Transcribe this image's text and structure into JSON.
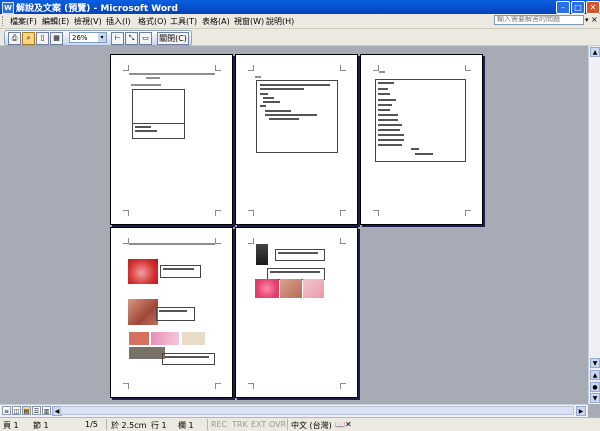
{
  "window": {
    "title": "解說及文案 (預覽) - Microsoft Word",
    "app_icon": "W",
    "min_glyph": "–",
    "max_glyph": "□",
    "close_glyph": "✕"
  },
  "menu": {
    "items": [
      "檔案(F)",
      "編輯(E)",
      "檢視(V)",
      "插入(I)",
      "格式(O)",
      "工具(T)",
      "表格(A)",
      "視窗(W)",
      "說明(H)"
    ],
    "help_placeholder": "輸入需要解答的問題",
    "help_arrow": "▾",
    "close_glyph": "×"
  },
  "toolbar": {
    "zoom_value": "26%",
    "zoom_arrow": "▾",
    "close_preview_label": "關閉(C)"
  },
  "status": {
    "page": "頁 1",
    "section": "節 1",
    "page_of": "1/5",
    "position": "於 2.5cm",
    "line": "行 1",
    "column": "欄 1",
    "rec": "REC",
    "trk": "TRK",
    "ext": "EXT",
    "ovr": "OVR",
    "language": "中文 (台灣)"
  },
  "scroll": {
    "up": "▲",
    "down": "▼",
    "prev_page": "▲",
    "next_page": "▼",
    "left": "◀",
    "right": "▶"
  }
}
